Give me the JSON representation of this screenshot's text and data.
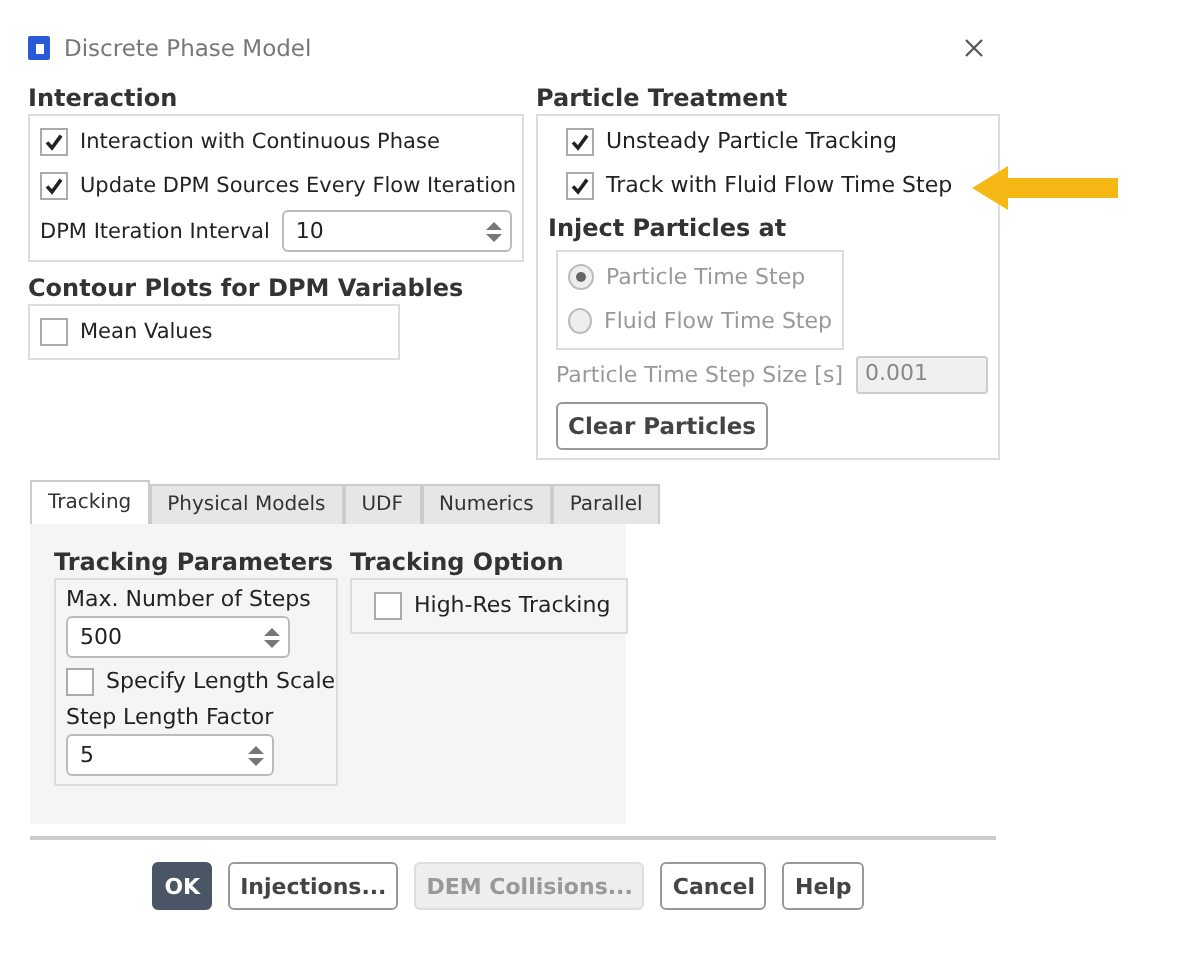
{
  "window": {
    "title": "Discrete Phase Model"
  },
  "interaction": {
    "heading": "Interaction",
    "options": [
      {
        "label": "Interaction with Continuous Phase",
        "checked": true
      },
      {
        "label": "Update DPM Sources Every Flow Iteration",
        "checked": true
      }
    ],
    "interval": {
      "label": "DPM Iteration Interval",
      "value": "10"
    }
  },
  "contour_plots": {
    "heading": "Contour Plots for DPM Variables",
    "options": [
      {
        "label": "Mean Values",
        "checked": false
      }
    ]
  },
  "particle_treatment": {
    "heading": "Particle Treatment",
    "options": [
      {
        "label": "Unsteady Particle Tracking",
        "checked": true
      },
      {
        "label": "Track with Fluid Flow Time Step",
        "checked": true
      }
    ],
    "inject_heading": "Inject Particles at",
    "inject_options": [
      {
        "label": "Particle Time Step",
        "selected": true,
        "disabled": true
      },
      {
        "label": "Fluid Flow Time Step",
        "selected": false,
        "disabled": true
      }
    ],
    "step_size": {
      "label": "Particle Time Step Size [s]",
      "value": "0.001",
      "disabled": true
    },
    "clear_button": "Clear Particles"
  },
  "tabs": [
    {
      "label": "Tracking",
      "selected": true
    },
    {
      "label": "Physical Models",
      "selected": false
    },
    {
      "label": "UDF",
      "selected": false
    },
    {
      "label": "Numerics",
      "selected": false
    },
    {
      "label": "Parallel",
      "selected": false
    }
  ],
  "tracking_parameters": {
    "heading": "Tracking Parameters",
    "fields": [
      {
        "kind": "spinner",
        "label": "Max. Number of Steps",
        "value": "500"
      },
      {
        "kind": "checkbox",
        "label": "Specify Length Scale",
        "checked": false
      },
      {
        "kind": "spinner",
        "label": "Step Length Factor",
        "value": "5"
      }
    ]
  },
  "tracking_option": {
    "heading": "Tracking Option",
    "options": [
      {
        "label": "High-Res Tracking",
        "checked": false
      }
    ]
  },
  "buttons": [
    {
      "label": "OK",
      "kind": "default"
    },
    {
      "label": "Injections...",
      "kind": "normal"
    },
    {
      "label": "DEM Collisions...",
      "kind": "disabled"
    },
    {
      "label": "Cancel",
      "kind": "normal"
    },
    {
      "label": "Help",
      "kind": "normal"
    }
  ]
}
